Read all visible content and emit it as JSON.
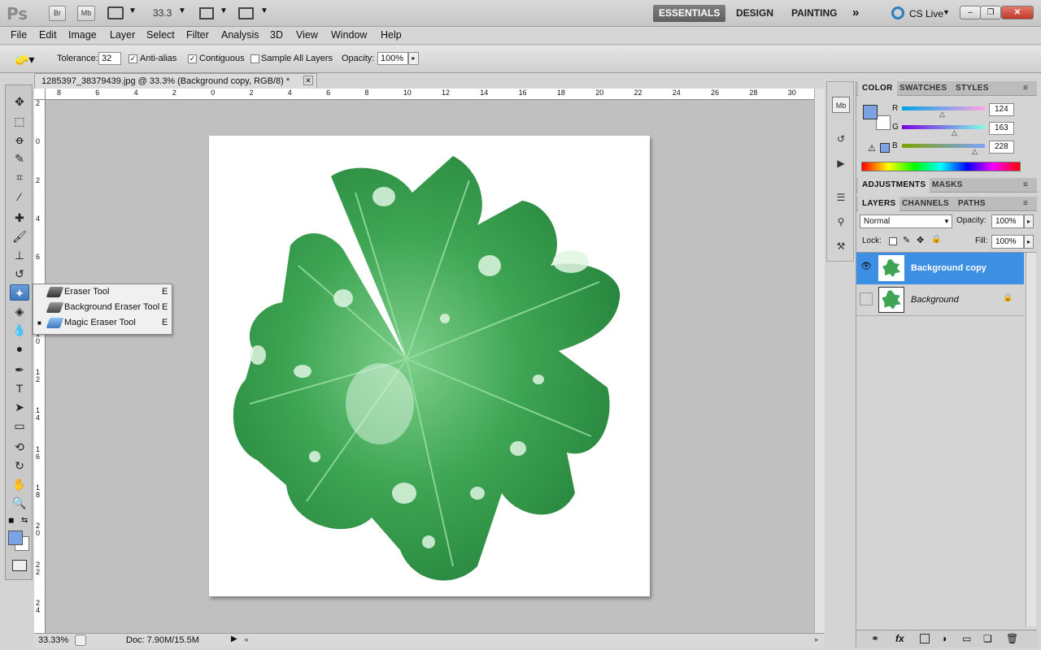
{
  "app": {
    "logo": "Ps",
    "bridge": "Br",
    "minibridge": "Mb",
    "zoom": "33.3"
  },
  "workspaces": [
    "ESSENTIALS",
    "DESIGN",
    "PAINTING"
  ],
  "cs_live": "CS Live",
  "menu": [
    "File",
    "Edit",
    "Image",
    "Layer",
    "Select",
    "Filter",
    "Analysis",
    "3D",
    "View",
    "Window",
    "Help"
  ],
  "options": {
    "tolerance_label": "Tolerance:",
    "tolerance": "32",
    "antialias_label": "Anti-alias",
    "contiguous_label": "Contiguous",
    "sample_label": "Sample All Layers",
    "opacity_label": "Opacity:",
    "opacity": "100%"
  },
  "document": {
    "tab_title": "1285397_38379439.jpg @ 33.3% (Background copy, RGB/8) *"
  },
  "ruler": {
    "h": [
      "8",
      "6",
      "4",
      "2",
      "0",
      "2",
      "4",
      "6",
      "8",
      "10",
      "12",
      "14",
      "16",
      "18",
      "20",
      "22",
      "24",
      "26",
      "28",
      "30"
    ],
    "v": [
      "2",
      "0",
      "2",
      "4",
      "6",
      "8",
      "1\n0",
      "1\n2",
      "1\n4",
      "1\n6",
      "1\n8",
      "2\n0",
      "2\n2",
      "2\n4"
    ]
  },
  "flyout": [
    {
      "label": "Eraser Tool",
      "key": "E"
    },
    {
      "label": "Background Eraser Tool",
      "key": "E"
    },
    {
      "label": "Magic Eraser Tool",
      "key": "E"
    }
  ],
  "status": {
    "zoom": "33.33%",
    "doc": "Doc: 7.90M/15.5M"
  },
  "panels": {
    "color_tabs": [
      "COLOR",
      "SWATCHES",
      "STYLES"
    ],
    "rgb": [
      {
        "ch": "R",
        "val": "124"
      },
      {
        "ch": "G",
        "val": "163"
      },
      {
        "ch": "B",
        "val": "228"
      }
    ],
    "fg_color": "#7ca3e4",
    "adj_tabs": [
      "ADJUSTMENTS",
      "MASKS"
    ],
    "layer_tabs": [
      "LAYERS",
      "CHANNELS",
      "PATHS"
    ],
    "blend": "Normal",
    "opacity_label": "Opacity:",
    "opacity": "100%",
    "lock_label": "Lock:",
    "fill_label": "Fill:",
    "fill": "100%",
    "layers": [
      "Background copy",
      "Background"
    ]
  }
}
